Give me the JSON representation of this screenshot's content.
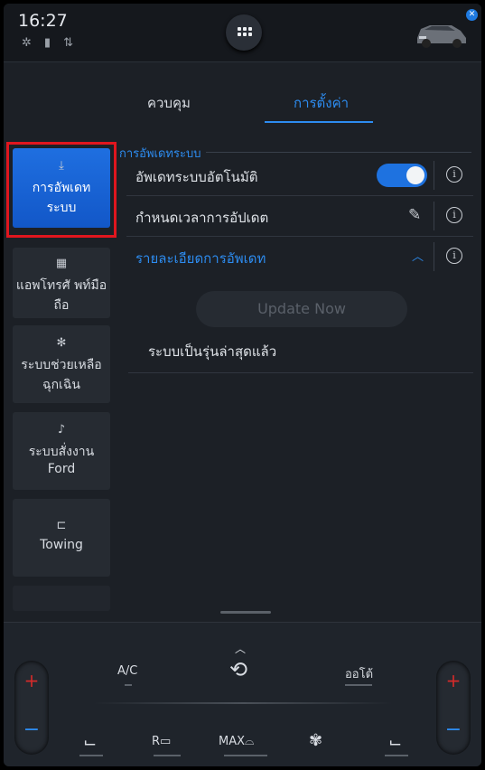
{
  "status_bar": {
    "time": "16:27",
    "icons": [
      "fan-off-icon",
      "battery-icon",
      "signal-icon"
    ]
  },
  "tabs": [
    {
      "label": "ควบคุม",
      "active": false
    },
    {
      "label": "การตั้งค่า",
      "active": true
    }
  ],
  "sidebar": {
    "items": [
      {
        "icon": "download-icon",
        "label_line1": "การอัพเดท",
        "label_line2": "ระบบ",
        "active": true
      },
      {
        "icon": "apps-grid-icon",
        "label_line1": "แอพโทรศั พท์มือ",
        "label_line2": "ถือ",
        "active": false
      },
      {
        "icon": "emergency-icon",
        "label_line1": "ระบบช่วยเหลือ",
        "label_line2": "ฉุกเฉิน",
        "active": false
      },
      {
        "icon": "voice-icon",
        "label_line1": "ระบบสั่งงาน",
        "label_line2": "Ford",
        "active": false
      },
      {
        "icon": "trailer-icon",
        "label_line1": "Towing",
        "label_line2": "",
        "active": false
      }
    ]
  },
  "main": {
    "section_title": "การอัพเดทระบบ",
    "rows": [
      {
        "label": "อัพเดทระบบอัตโนมัติ",
        "control": "toggle",
        "value": "on"
      },
      {
        "label": "กำหนดเวลาการอัปเดต",
        "control": "edit"
      },
      {
        "label": "รายละเอียดการอัพเดท",
        "control": "expand",
        "expanded": true
      }
    ],
    "update_button": "Update Now",
    "status_message": "ระบบเป็นรุ่นล่าสุดแล้ว"
  },
  "climate": {
    "ac_label": "A/C",
    "auto_label": "ออโต้",
    "rear_defrost_label": "R",
    "max_defrost_label": "MAX",
    "temp_plus": "+",
    "temp_minus": "−"
  },
  "colors": {
    "accent": "#2d8cf0",
    "active_item": "#1f6fe0",
    "highlight_frame": "#e0161e",
    "background": "#1c2026"
  }
}
